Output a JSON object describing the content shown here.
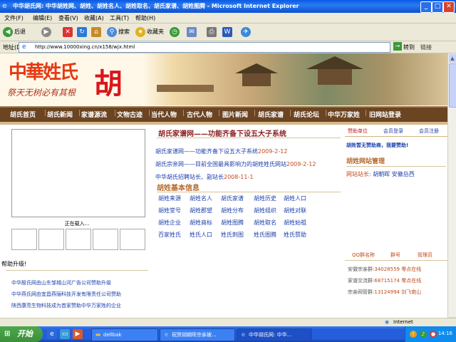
{
  "window": {
    "title": "中华胡氏网: 中华胡姓网、胡姓、胡姓名人、胡姓取名、胡氏家谱、胡姓图腾 - Microsoft Internet Explorer",
    "min": "_",
    "max": "□",
    "close": "✕"
  },
  "menu": [
    "文件(F)",
    "编辑(E)",
    "查看(V)",
    "收藏(A)",
    "工具(T)",
    "帮助(H)"
  ],
  "toolbar": {
    "back": "后退",
    "search": "搜索",
    "favorites": "收藏夹"
  },
  "address": {
    "label": "地址(D)",
    "url": "http://www.10000xing.cn/x158/wjx.html",
    "go": "转到",
    "links": "链接"
  },
  "site": {
    "logo": "中華姓氏",
    "slogan": "祭天无树必有其根",
    "surname": "胡",
    "nav": [
      "胡氏首页",
      "胡氏新闻",
      "家谱源流",
      "文物古迹",
      "当代人物",
      "古代人物",
      "图片新闻",
      "胡氏家谱",
      "胡氏论坛",
      "中华万家姓",
      "旧网站登录"
    ],
    "left": {
      "loading": "正在载入...",
      "thanks": "帮助升级!",
      "sponsors": [
        "中华殷氏网由山东邹城山河广告公司赞助升级",
        "中华燕氏网由宜昌燕骊科技开发有限责任公司赞助",
        "陕西康亮生物科技成为首家赞助中华万家姓的企业"
      ]
    },
    "middle": {
      "headline": "胡氏家谱网——功能齐备下设五大子系统",
      "news": [
        {
          "text": "胡氏家谱网——功能齐备下设五大子系统",
          "date": "2009-2-12"
        },
        {
          "text": "胡氏宗亲网——目前全国最具影响力的胡姓姓氏网站",
          "date": "2009-2-12"
        },
        {
          "text": "中华胡氏招聘站长、副站长",
          "date": "2008-11-1"
        }
      ],
      "section": "胡姓基本信息",
      "links": [
        "胡姓来源",
        "胡姓名人",
        "胡氏家谱",
        "胡姓历史",
        "胡姓人口",
        "胡姓堂号",
        "胡姓郡望",
        "胡姓分布",
        "胡姓组织",
        "胡姓对联",
        "胡姓企业",
        "胡姓商标",
        "胡姓图腾",
        "胡姓取名",
        "胡姓始祖",
        "百家姓氏",
        "姓氏人口",
        "姓氏刺图",
        "姓氏图腾",
        "姓氏赞助"
      ]
    },
    "right": {
      "tabs": [
        "赞助单位",
        "会员登录",
        "会员注册"
      ],
      "tab_message": "胡姓暂无赞助商，我要赞助!",
      "admin_title": "胡姓网站管理",
      "admin_label": "网站站长:",
      "admin_names": "胡朝晖 安徽岳西",
      "qq_headers": [
        "QQ群名称",
        "群号",
        "管理员"
      ],
      "qq_rows": [
        {
          "name": "安徽宗亲群:",
          "value": "34028559 零点在线"
        },
        {
          "name": "家谱交流群:",
          "value": "68715174 零点在线"
        },
        {
          "name": "宗亲网管群:",
          "value": "13124994 剑飞南山"
        }
      ]
    }
  },
  "status": {
    "zone": "Internet"
  },
  "taskbar": {
    "start": "开始",
    "tasks": [
      "dellbak",
      "祝贺胡朝晖宗亲被...",
      "中华胡氏网: 中华..."
    ],
    "clock": "14:16"
  }
}
